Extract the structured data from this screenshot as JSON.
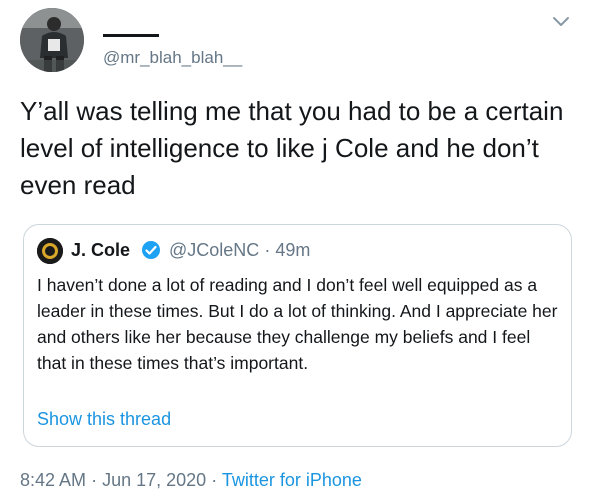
{
  "author": {
    "handle": "@mr_blah_blah__",
    "avatar_icon": "user-avatar-photo"
  },
  "tweet": {
    "text": "Y’all was telling me that you had to be a certain level of intelligence to like j Cole and he don’t even read"
  },
  "quoted": {
    "name": "J. Cole",
    "handle": "@JColeNC",
    "separator": "·",
    "time_ago": "49m",
    "verified_icon": "verified-badge-icon",
    "text": "I haven’t done a lot of reading and I don’t feel well equipped as a leader in these times. But I do a lot of thinking. And I appreciate her and others like her because they challenge my beliefs and I feel that in these times that’s important.",
    "show_thread_label": "Show this thread"
  },
  "meta": {
    "time": "8:42 AM",
    "separator": "·",
    "date": "Jun 17, 2020",
    "source": "Twitter for iPhone"
  },
  "colors": {
    "link": "#1b95e0",
    "secondary_text": "#657786",
    "verified": "#1da1f2",
    "border": "#ccd6dd"
  }
}
